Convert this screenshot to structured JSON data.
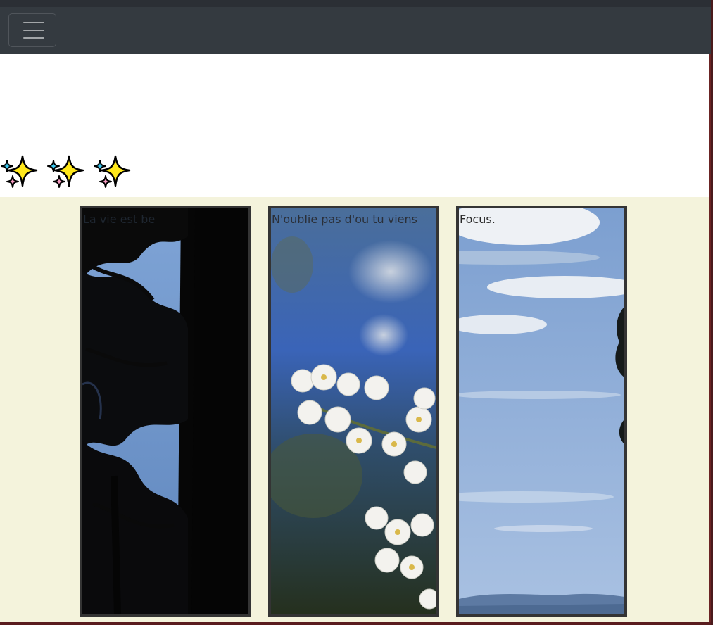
{
  "navbar": {
    "toggler_icon": "hamburger-menu-icon",
    "background_color": "#343a40"
  },
  "sparkles": [
    "sparkles-icon",
    "sparkles-icon",
    "sparkles-icon"
  ],
  "gallery": {
    "background_color": "#f4f3dc",
    "cards": [
      {
        "caption": "La vie est be",
        "photo": "dark pine tree silhouette against blue sky"
      },
      {
        "caption": "N'oublie pas d'ou tu viens",
        "photo": "white cherry blossoms on blurred blue background"
      },
      {
        "caption": "Focus.",
        "photo": "blue sky with clouds and distant hills"
      }
    ]
  }
}
